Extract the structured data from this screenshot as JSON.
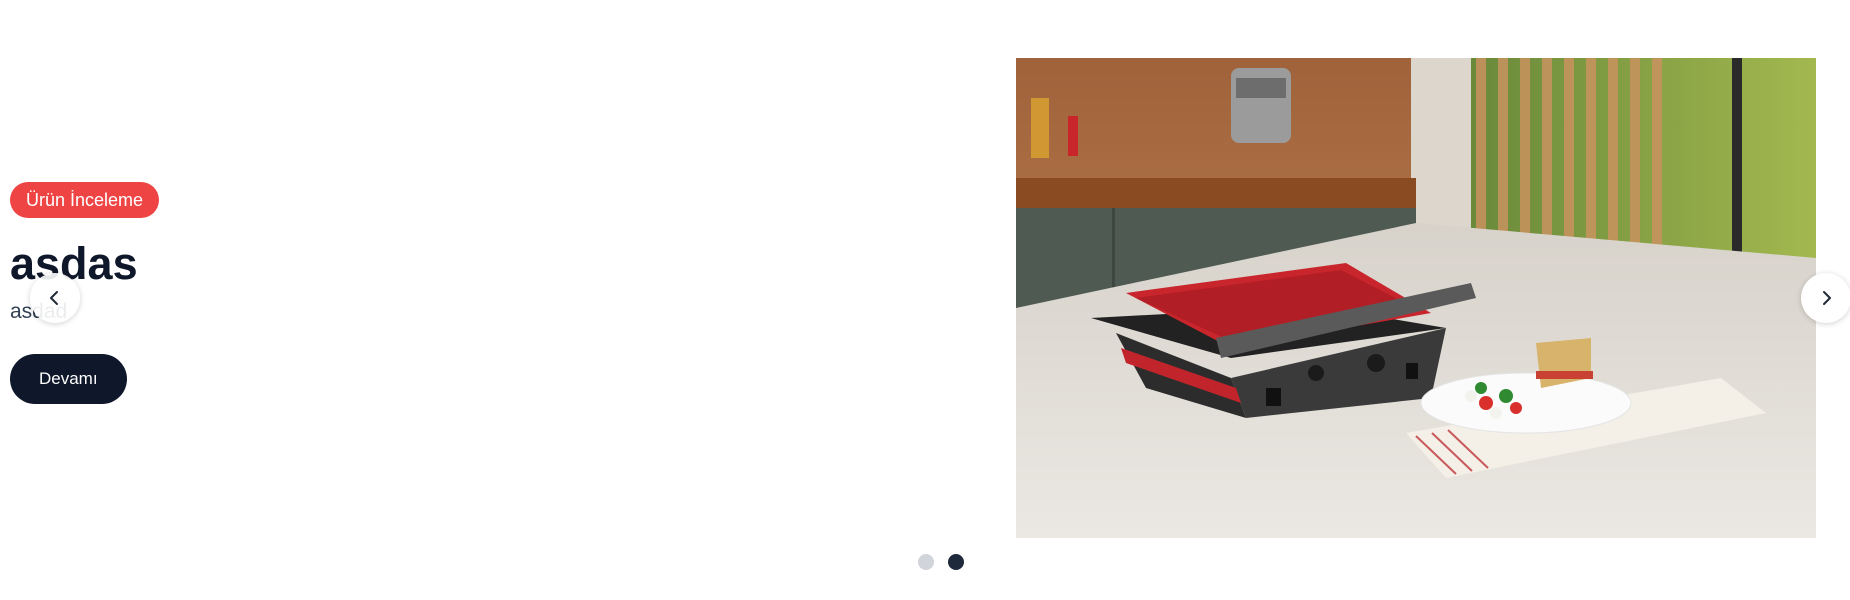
{
  "slide": {
    "badge": "Ürün İnceleme",
    "title": "asdas",
    "subtitle": "asdad",
    "cta_label": "Devamı"
  },
  "image": {
    "alt": "Arzum red table grill on marble kitchen counter with sandwich and salad"
  },
  "carousel": {
    "total_slides": 2,
    "active_index": 1
  },
  "colors": {
    "badge_bg": "#ef4444",
    "title_text": "#0f172a",
    "cta_bg": "#0f172a",
    "dot_active": "#1e293b",
    "dot_inactive": "#d1d5db"
  },
  "icons": {
    "prev": "chevron-left-icon",
    "next": "chevron-right-icon"
  }
}
